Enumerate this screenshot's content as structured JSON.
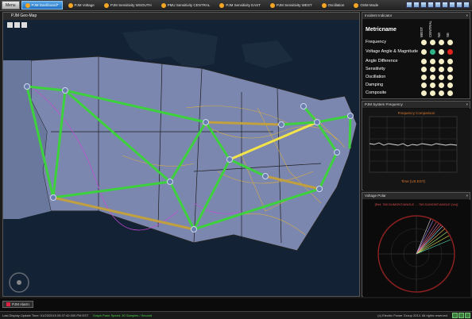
{
  "menu": {
    "label": "Menu"
  },
  "tabs": [
    {
      "label": "PJM Dashboard*",
      "active": true
    },
    {
      "label": "PJM Voltage"
    },
    {
      "label": "PJM Sensitivity WSOUTH"
    },
    {
      "label": "PMU Sensitivity CENTRAL"
    },
    {
      "label": "PJM Sensitivity EAST"
    },
    {
      "label": "PJM Sensitivity WEST"
    },
    {
      "label": "Oscillation"
    },
    {
      "label": "OSM Mode"
    }
  ],
  "map": {
    "title": "PJM Geo-Map"
  },
  "incident": {
    "title": "Incident Indicator",
    "metric_header": "Metricname",
    "columns": [
      "WEST",
      "CENTRAL",
      "NE",
      "SE"
    ],
    "rows": [
      {
        "name": "Frequency",
        "status": [
          "#f4efc7",
          "#f4efc7",
          "#f4efc7",
          "#f4efc7"
        ]
      },
      {
        "name": "Voltage Angle & Magnitude",
        "status": [
          "#f4efc7",
          "#2fb389",
          "#f4efc7",
          "#e0241b"
        ]
      },
      {
        "name": "Angle Difference",
        "status": [
          "#f4efc7",
          "#f4efc7",
          "#f4efc7",
          "#f4efc7"
        ]
      },
      {
        "name": "Sensitivity",
        "status": [
          "#f4efc7",
          "#f4efc7",
          "#f4efc7",
          "#f4efc7"
        ]
      },
      {
        "name": "Oscillation",
        "status": [
          "#f4efc7",
          "#f4efc7",
          "#f4efc7",
          "#f4efc7"
        ]
      },
      {
        "name": "Damping",
        "status": [
          "#f4efc7",
          "#f4efc7",
          "#f4efc7",
          "#f4efc7"
        ]
      },
      {
        "name": "Composite",
        "status": [
          "#f4efc7",
          "#f4efc7",
          "#f4efc7",
          "#f4efc7"
        ]
      }
    ]
  },
  "frequency": {
    "title": "PJM System Frequency",
    "chart_title": "Frequency Comparison",
    "xlabel": "Time (US EST)"
  },
  "polar": {
    "title": "Voltage Polar",
    "chart_title": "[Ref: 765 DUMONT/ANGLE ... 765 DUMONT/ANGLE (Vc)]"
  },
  "alarm": {
    "label": "PJM Alarm"
  },
  "status": {
    "left": "Last Display Update Time: 01/23/2015 05:37:40.000 PM EST",
    "middle": "Graph Pane Speed: 30 Samples / Second",
    "right": "(c) Electric Power Group 2014. All rights reserved."
  }
}
